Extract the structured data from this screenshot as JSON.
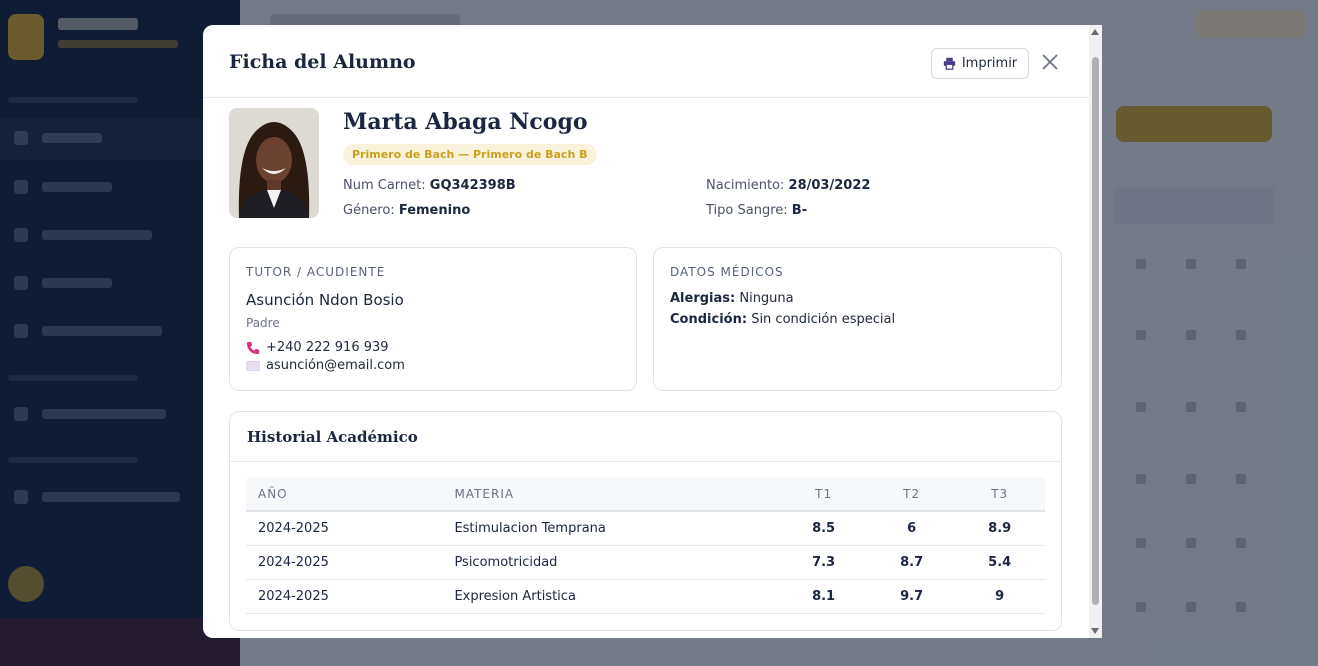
{
  "modal": {
    "title": "Ficha del Alumno",
    "print_label": "Imprimir"
  },
  "student": {
    "name": "Marta Abaga Ncogo",
    "course_badge": "Primero de Bach — Primero de Bach B",
    "carnet_label": "Num Carnet:",
    "carnet_value": "GQ342398B",
    "gender_label": "Género:",
    "gender_value": "Femenino",
    "birth_label": "Nacimiento:",
    "birth_value": "28/03/2022",
    "blood_label": "Tipo Sangre:",
    "blood_value": "B-"
  },
  "tutor": {
    "section_label": "TUTOR / ACUDIENTE",
    "name": "Asunción Ndon Bosio",
    "relation": "Padre",
    "phone": "+240 222 916 939",
    "email": "asunción@email.com"
  },
  "medical": {
    "section_label": "DATOS MÉDICOS",
    "allergies_label": "Alergias:",
    "allergies_value": "Ninguna",
    "condition_label": "Condición:",
    "condition_value": "Sin condición especial"
  },
  "history": {
    "title": "Historial Académico",
    "columns": [
      "AÑO",
      "MATERIA",
      "T1",
      "T2",
      "T3"
    ],
    "rows": [
      {
        "year": "2024-2025",
        "subject": "Estimulacion Temprana",
        "t1": "8.5",
        "t2": "6",
        "t3": "8.9"
      },
      {
        "year": "2024-2025",
        "subject": "Psicomotricidad",
        "t1": "7.3",
        "t2": "8.7",
        "t3": "5.4"
      },
      {
        "year": "2024-2025",
        "subject": "Expresion Artistica",
        "t1": "8.1",
        "t2": "9.7",
        "t3": "9"
      }
    ]
  },
  "colors": {
    "accent_gold": "#c9a431",
    "badge_bg": "#fbf2dc",
    "navy": "#1b2640",
    "phone_icon": "#d63384"
  },
  "icons": {
    "print": "printer-icon",
    "close": "close-icon",
    "phone": "phone-icon",
    "email": "envelope-icon"
  }
}
